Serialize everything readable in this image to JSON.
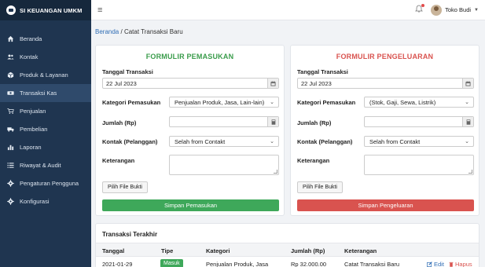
{
  "app": {
    "title": "SI KEUANGAN UMKM"
  },
  "sidebar": {
    "items": [
      {
        "label": "Beranda",
        "icon": "home-icon"
      },
      {
        "label": "Kontak",
        "icon": "users-icon"
      },
      {
        "label": "Produk & Layanan",
        "icon": "box-icon"
      },
      {
        "label": "Transaksi Kas",
        "icon": "cash-icon",
        "active": true
      },
      {
        "label": "Penjualan",
        "icon": "cart-icon"
      },
      {
        "label": "Pembelian",
        "icon": "truck-icon"
      },
      {
        "label": "Laporan",
        "icon": "bar-chart-icon"
      },
      {
        "label": "Riwayat & Audit",
        "icon": "list-icon"
      },
      {
        "label": "Pengaturan Pengguna",
        "icon": "gear-icon"
      },
      {
        "label": "Konfigurasi",
        "icon": "gear-icon"
      }
    ]
  },
  "topbar": {
    "user_name": "Toko Budi"
  },
  "breadcrumb": {
    "home": "Beranda",
    "separator": "/",
    "current": "Catat Transaksi Baru"
  },
  "income_form": {
    "title": "FORMULIR PEMASUKAN",
    "date_label": "Tanggal Transaksi",
    "date_value": "22 Jul 2023",
    "category_label": "Kategori Pemasukan",
    "category_value": "Penjualan Produk, Jasa, Lain-lain)",
    "amount_label": "Jumlah (Rp)",
    "contact_label": "Kontak (Pelanggan)",
    "contact_value": "Selah from Contakt",
    "note_label": "Keterangan",
    "file_button": "Pilih File Bukti",
    "submit_button": "Simpan Pemasukan"
  },
  "expense_form": {
    "title": "FORMULIR PENGELUARAN",
    "date_label": "Tanggal Transaksi",
    "date_value": "22 Jul 2023",
    "category_label": "Kategori Pemasukan",
    "category_value": "(Stok, Gaji, Sewa, Listrik)",
    "amount_label": "Jumlah (Rp)",
    "contact_label": "Kontak (Pelanggan)",
    "contact_value": "Selah from Contakt",
    "note_label": "Keterangan",
    "file_button": "Pilih File Bukti",
    "submit_button": "Simpan Pengeluaran"
  },
  "recent": {
    "title": "Transaksi Terakhir",
    "columns": [
      "Tanggal",
      "Tipe",
      "Kategori",
      "Jumlah (Rp)",
      "Keterangan"
    ],
    "rows": [
      {
        "date": "2021-01-29",
        "type": "Masuk",
        "category": "Penjualan Produk, Jasa",
        "amount": "Rp 32.000.00",
        "note": "Catat Transaksi Baru",
        "edit": "Edit",
        "delete": "Hapus"
      }
    ]
  },
  "colors": {
    "sidebar": "#1f3550",
    "accent_green": "#3ea85a",
    "accent_red": "#d9534f",
    "link": "#2f6db5"
  }
}
